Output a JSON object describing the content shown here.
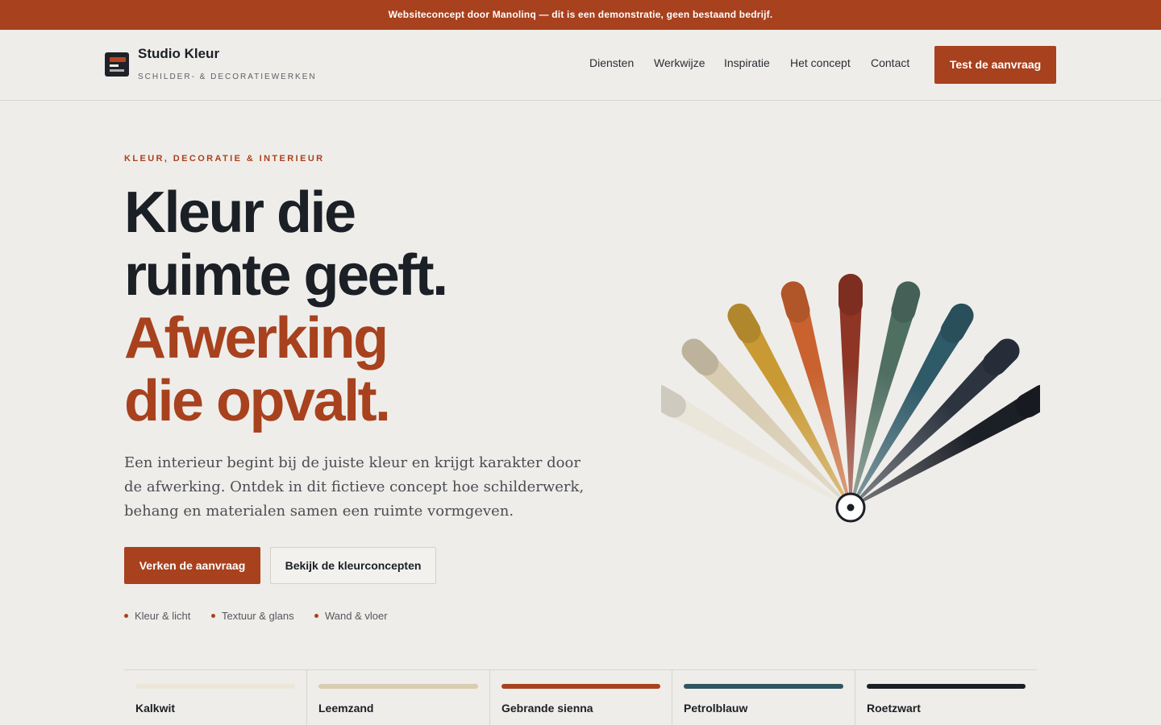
{
  "banner": {
    "text": "Websiteconcept door Manolinq — dit is een demonstratie, geen bestaand bedrijf."
  },
  "brand": {
    "name": "Studio Kleur",
    "tagline": "SCHILDER- & DECORATIEWERKEN",
    "logo_icon": "paint-swatch-logo"
  },
  "nav": {
    "items": [
      "Diensten",
      "Werkwijze",
      "Inspiratie",
      "Het concept",
      "Contact"
    ],
    "cta": "Test de aanvraag"
  },
  "hero": {
    "eyebrow": "KLEUR, DECORATIE & INTERIEUR",
    "title_lines": [
      "Kleur die",
      "ruimte geeft.",
      "Afwerking",
      "die opvalt."
    ],
    "lead": "Een interieur begint bij de juiste kleur en krijgt karakter door de afwerking. Ontdek in dit fictieve concept hoe schilderwerk, behang en materialen samen een ruimte vormgeven.",
    "primary_cta": "Verken de aanvraag",
    "secondary_cta": "Bekijk de kleurconcepten",
    "tags": [
      "Kleur & licht",
      "Textuur & glans",
      "Wand & vloer"
    ]
  },
  "fan": {
    "illustration": "color-fan-deck",
    "colors": [
      "#ebe6da",
      "#d8ccb2",
      "#c99a33",
      "#c9622f",
      "#8f3526",
      "#4f6f63",
      "#2f5a68",
      "#2c3440",
      "#1b1f26"
    ]
  },
  "swatches": [
    {
      "name": "Kalkwit",
      "color": "#ece6da"
    },
    {
      "name": "Leemzand",
      "color": "#d9ccb0"
    },
    {
      "name": "Gebrande sienna",
      "color": "#a8411e"
    },
    {
      "name": "Petrolblauw",
      "color": "#2f5661"
    },
    {
      "name": "Roetzwart",
      "color": "#1b1f26"
    }
  ],
  "accent_color": "#a8411e"
}
